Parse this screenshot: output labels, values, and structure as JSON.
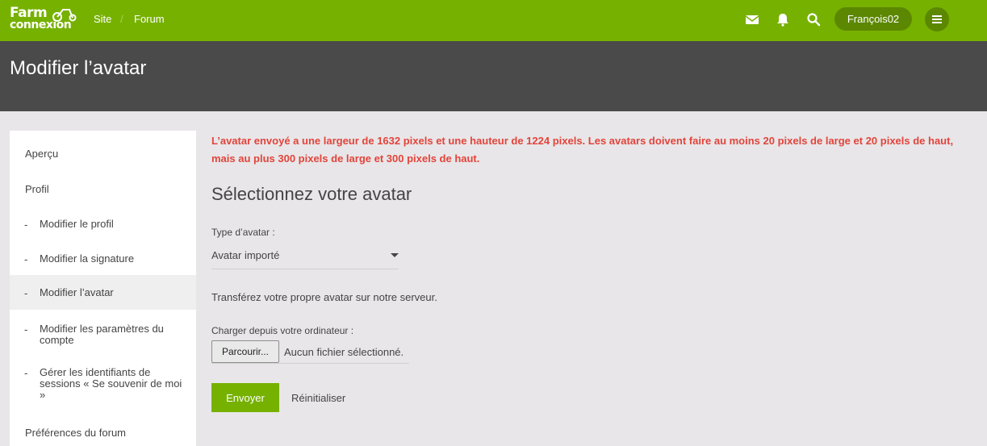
{
  "app": {
    "logo_line1": "Farm",
    "logo_line2": "connexion",
    "nav": [
      {
        "label": "Site"
      },
      {
        "label": "Forum"
      }
    ],
    "nav_separator": "/",
    "user_name": "François02",
    "accent_color": "#76b100"
  },
  "header": {
    "title": "Modifier l’avatar"
  },
  "sidebar": {
    "items": [
      {
        "label": "Aperçu",
        "level": 0
      },
      {
        "label": "Profil",
        "level": 0
      },
      {
        "label": "Modifier le profil",
        "level": 1
      },
      {
        "label": "Modifier la signature",
        "level": 1
      },
      {
        "label": "Modifier l’avatar",
        "level": 1,
        "active": true
      },
      {
        "label": "Modifier les paramètres du compte",
        "level": 1
      },
      {
        "label": "Gérer les identifiants de sessions « Se souvenir de moi »",
        "level": 1
      },
      {
        "label": "Préférences du forum",
        "level": 0
      }
    ],
    "dash": "-"
  },
  "main": {
    "error": "L’avatar envoyé a une largeur de 1632 pixels et une hauteur de 1224 pixels. Les avatars doivent faire au moins 20 pixels de large et 20 pixels de haut, mais au plus 300 pixels de large et 300 pixels de haut.",
    "error_color": "#e2443b",
    "section_title": "Sélectionnez votre avatar",
    "avatar_type_label": "Type d’avatar :",
    "avatar_type_value": "Avatar importé",
    "info": "Transférez votre propre avatar sur notre serveur.",
    "upload_label": "Charger depuis votre ordinateur :",
    "browse_label": "Parcourir...",
    "file_status": "Aucun fichier sélectionné.",
    "submit_label": "Envoyer",
    "reset_label": "Réinitialiser"
  }
}
